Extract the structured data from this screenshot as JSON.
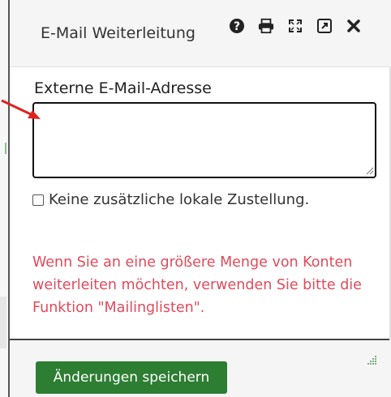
{
  "dialog": {
    "title": "E-Mail Weiterleitung",
    "header_icons": [
      "help-icon",
      "print-icon",
      "expand-icon",
      "external-link-icon",
      "close-icon"
    ]
  },
  "form": {
    "email_label": "Externe E-Mail-Adresse",
    "email_value": "",
    "checkbox_label": "Keine zusätzliche lokale Zustellung.",
    "checkbox_checked": false
  },
  "notice": {
    "text": "Wenn Sie an eine größere Menge von Konten weiterleiten möchten, verwenden Sie bitte die Funktion \"Mailinglisten\"."
  },
  "footer": {
    "save_label": "Änderungen speichern"
  },
  "colors": {
    "accent_green": "#2d7d32",
    "notice_red": "#e04a5a",
    "annotation_red": "#e0221c"
  }
}
